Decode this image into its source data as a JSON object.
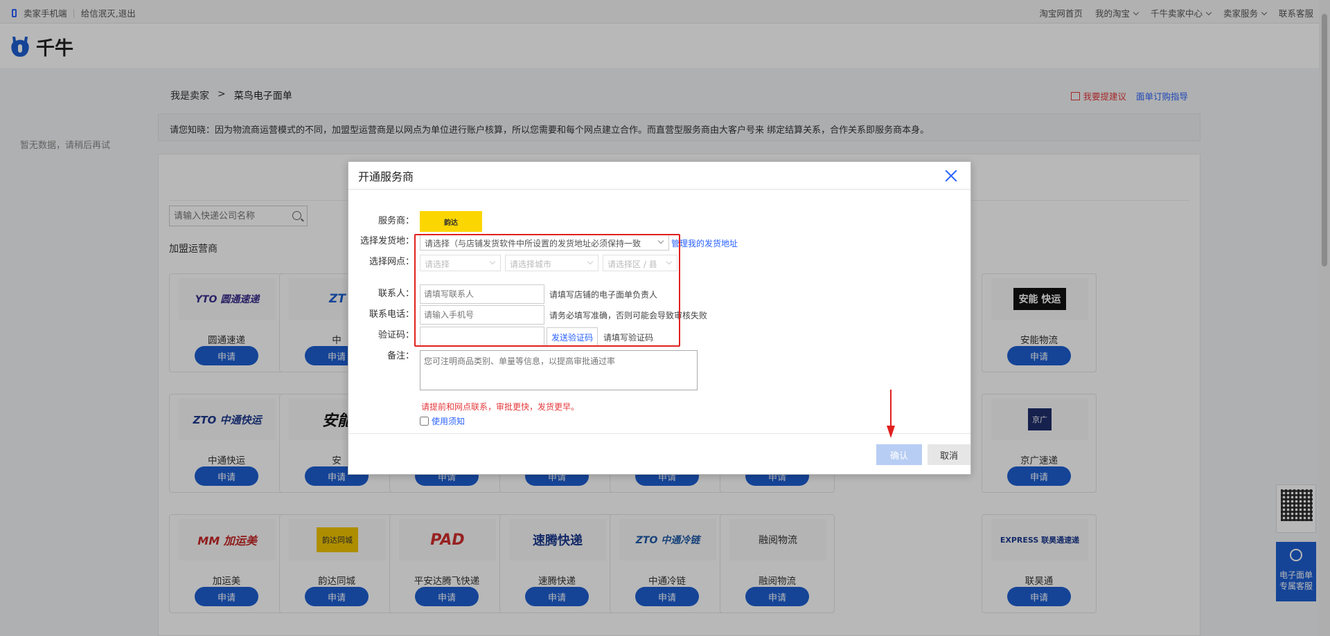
{
  "topbar": {
    "mobile": "卖家手机端",
    "user": "给信泯灭,退出",
    "links": [
      "淘宝网首页",
      "我的淘宝",
      "千牛卖家中心",
      "卖家服务",
      "联系客服"
    ]
  },
  "header": {
    "logo_text": "千牛"
  },
  "left": {
    "empty_text": "暂无数据，请稍后再试"
  },
  "breadcrumb": {
    "root": "我是卖家",
    "sep": ">",
    "current": "菜鸟电子面单"
  },
  "actions": {
    "suggest": "我要提建议",
    "guide": "面单订购指导"
  },
  "notice": "请您知晓：因为物流商运营模式的不同，加盟型运营商是以网点为单位进行账户核算，所以您需要和每个网点建立合作。而直营型服务商由大客户号来 绑定结算关系，合作关系即服务商本身。",
  "search": {
    "placeholder": "请输入快递公司名称"
  },
  "section": "加盟运营商",
  "apply_label": "申请",
  "cards": [
    {
      "name": "圆通速递",
      "logo": "YTO 圆通速递"
    },
    {
      "name": "中",
      "logo": "ZT"
    },
    {
      "name": "安能物流",
      "logo": "安能 快运"
    },
    {
      "name": "中通快运",
      "logo": "ZTO 中通快运"
    },
    {
      "name": "安",
      "logo": "安能"
    },
    {
      "name": "京广速递",
      "logo": "京广"
    },
    {
      "name": "加运美",
      "logo": "MM 加运美"
    },
    {
      "name": "韵达同城",
      "logo": "韵达同城"
    },
    {
      "name": "平安达腾飞快递",
      "logo": "PAD"
    },
    {
      "name": "速腾快递",
      "logo": "速腾快递"
    },
    {
      "name": "中通冷链",
      "logo": "ZTO 中通冷链"
    },
    {
      "name": "融阅物流",
      "logo": "融阅物流"
    },
    {
      "name": "联昊通",
      "logo": "EXPRESS 联昊通速递"
    }
  ],
  "dialog": {
    "title": "开通服务商",
    "labels": {
      "provider": "服务商：",
      "origin": "选择发货地：",
      "outlet": "选择网点：",
      "contact": "联系人：",
      "phone": "联系电话：",
      "code": "验证码：",
      "remark": "备注："
    },
    "provider_logo": "韵达",
    "origin_select": "请选择（与店铺发货软件中所设置的发货地址必须保持一致",
    "manage_link": "管理我的发货地址",
    "outlet_selects": [
      "请选择",
      "请选择城市",
      "请选择区 / 县"
    ],
    "contact_placeholder": "请填写联系人",
    "contact_hint": "请填写店铺的电子面单负责人",
    "phone_placeholder": "请输入手机号",
    "phone_hint": "请务必填写准确，否则可能会导致审核失败",
    "code_button": "发送验证码",
    "code_hint": "请填写验证码",
    "remark_placeholder": "您可注明商品类别、单量等信息，以提高审批通过率",
    "warning": "请提前和网点联系，审批更快，发货更早。",
    "agree_text": "使用须知",
    "ok": "确认",
    "cancel": "取消"
  },
  "float": {
    "service": "电子面单专属客服",
    "service_line1": "电子面单",
    "service_line2": "专属客服"
  }
}
